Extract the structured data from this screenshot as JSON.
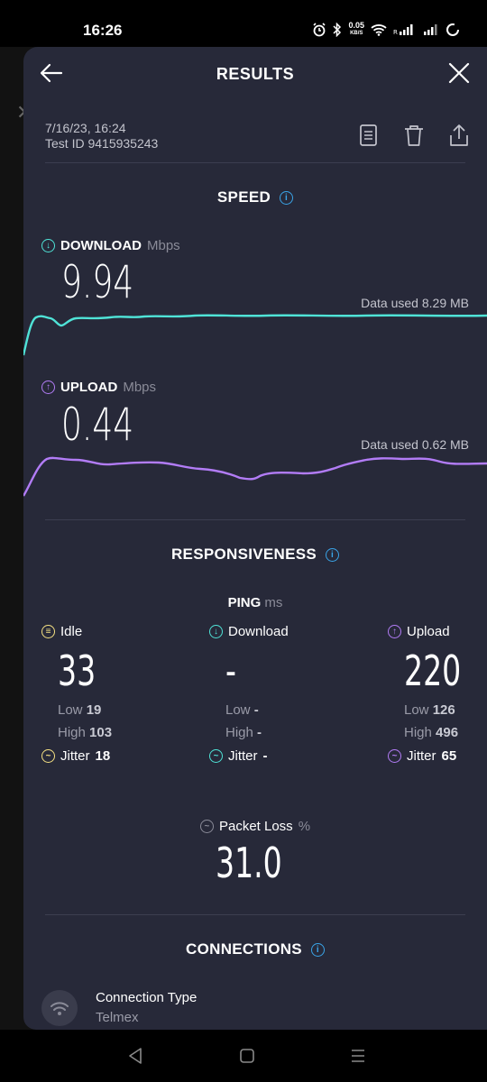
{
  "status_bar": {
    "time": "16:26",
    "net_speed": "0.05",
    "net_speed_unit": "KB/S",
    "icons": [
      "alarm-icon",
      "bluetooth-icon",
      "wifi-icon",
      "signal-icon",
      "signal-icon",
      "battery-icon"
    ]
  },
  "header": {
    "title": "RESULTS"
  },
  "meta": {
    "date": "7/16/23, 16:24",
    "test_id": "Test ID 9415935243"
  },
  "speed": {
    "title": "SPEED",
    "download": {
      "label": "DOWNLOAD",
      "unit": "Mbps",
      "value": "9.94",
      "data_used": "Data used 8.29 MB"
    },
    "upload": {
      "label": "UPLOAD",
      "unit": "Mbps",
      "value": "0.44",
      "data_used": "Data used 0.62 MB"
    }
  },
  "responsiveness": {
    "title": "RESPONSIVENESS",
    "ping_label": "PING",
    "ping_unit": "ms",
    "columns": [
      {
        "label": "Idle",
        "value": "33",
        "low_label": "Low",
        "low": "19",
        "high_label": "High",
        "high": "103",
        "jitter_label": "Jitter",
        "jitter": "18"
      },
      {
        "label": "Download",
        "value": "-",
        "low_label": "Low",
        "low": "-",
        "high_label": "High",
        "high": "-",
        "jitter_label": "Jitter",
        "jitter": "-"
      },
      {
        "label": "Upload",
        "value": "220",
        "low_label": "Low",
        "low": "126",
        "high_label": "High",
        "high": "496",
        "jitter_label": "Jitter",
        "jitter": "65"
      }
    ],
    "packet_loss": {
      "label": "Packet Loss",
      "unit": "%",
      "value": "31.0"
    }
  },
  "connections": {
    "title": "CONNECTIONS",
    "items": [
      {
        "label": "Connection Type",
        "value": "Telmex"
      }
    ]
  },
  "colors": {
    "accent_download": "#4fe3d7",
    "accent_upload": "#b27cf6",
    "accent_idle": "#f5e183",
    "info_blue": "#3aa4e8",
    "panel_bg": "#272939"
  }
}
